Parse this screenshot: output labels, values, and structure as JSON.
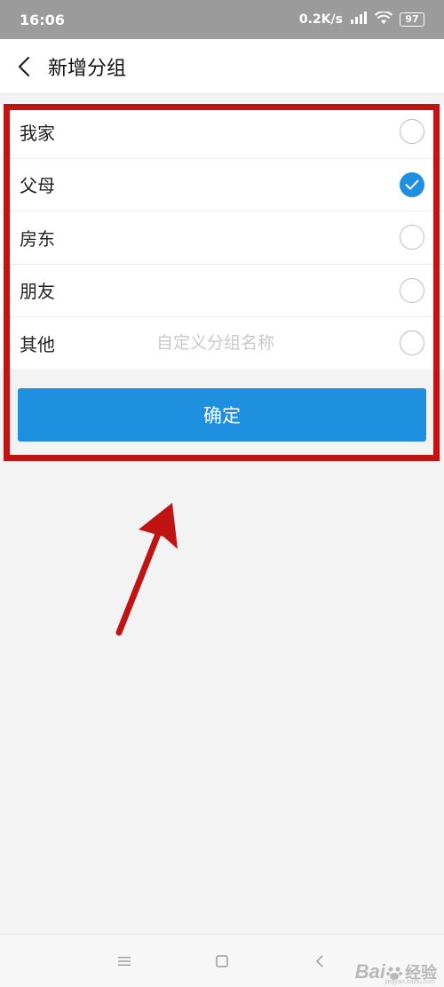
{
  "status_bar": {
    "time": "16:06",
    "network_speed": "0.2K/s",
    "battery_level": "97",
    "icons": [
      "signal-icon",
      "wifi-icon",
      "battery-icon"
    ]
  },
  "header": {
    "title": "新增分组",
    "back_icon": "chevron-left-icon"
  },
  "groups": [
    {
      "label": "我家",
      "checked": false
    },
    {
      "label": "父母",
      "checked": true
    },
    {
      "label": "房东",
      "checked": false
    },
    {
      "label": "朋友",
      "checked": false
    },
    {
      "label": "其他",
      "checked": false,
      "placeholder": "自定义分组名称"
    }
  ],
  "confirm_button": {
    "label": "确定"
  },
  "colors": {
    "accent": "#1f8fe0",
    "highlight": "#c01414",
    "background": "#f3f3f3",
    "status_bar": "#9b9b9b"
  },
  "nav_bar": {
    "icons": [
      "menu-icon",
      "home-icon",
      "back-icon"
    ]
  },
  "watermark": {
    "brand": "Bai",
    "sub": "经验",
    "url": "jingyan.baidu.com"
  }
}
